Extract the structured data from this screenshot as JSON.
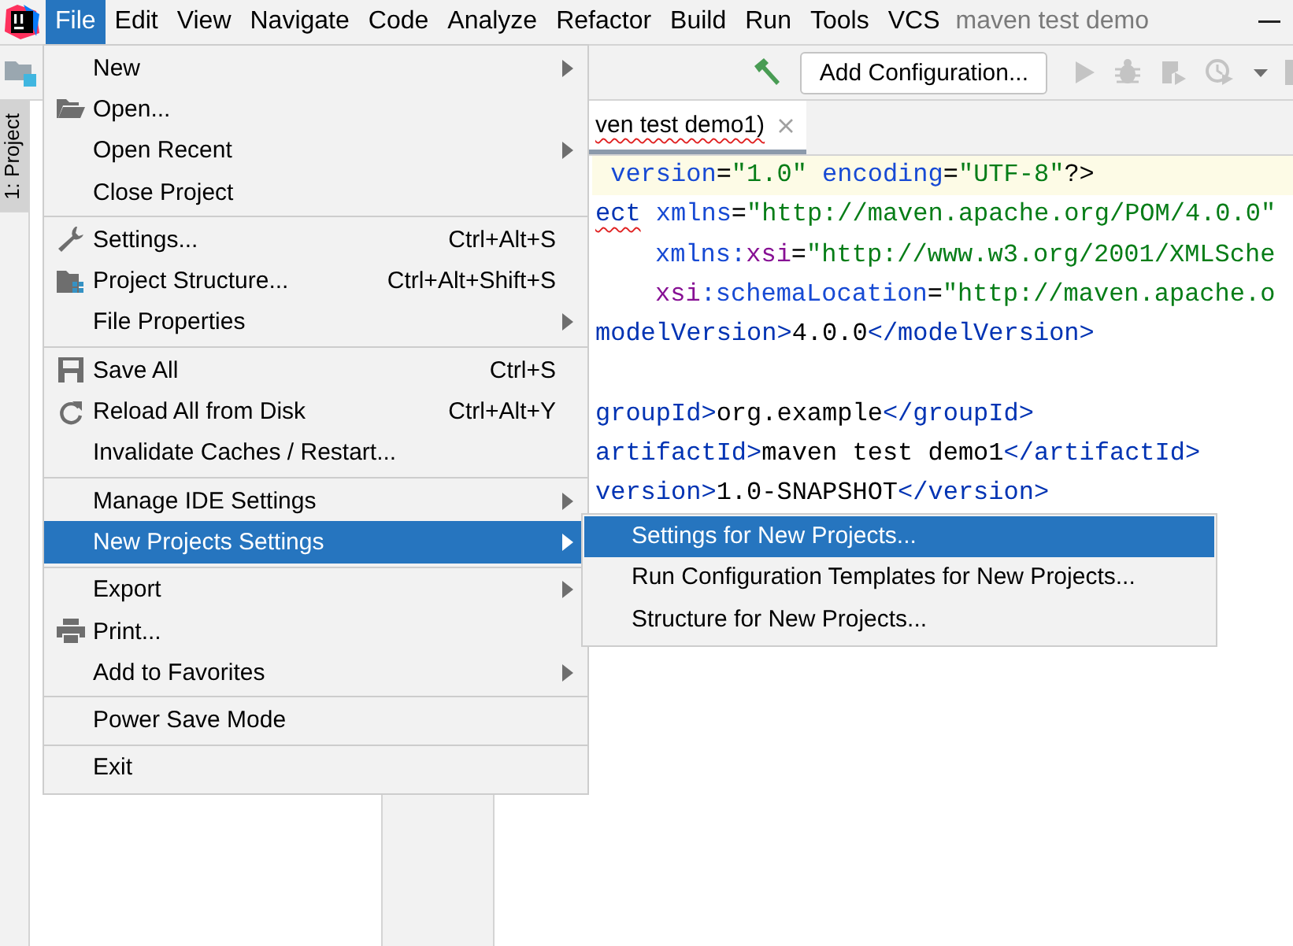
{
  "window": {
    "title": "maven test demo"
  },
  "menu_bar": [
    {
      "label": "File",
      "selected": true
    },
    {
      "label": "Edit",
      "selected": false
    },
    {
      "label": "View",
      "selected": false
    },
    {
      "label": "Navigate",
      "selected": false
    },
    {
      "label": "Code",
      "selected": false
    },
    {
      "label": "Analyze",
      "selected": false
    },
    {
      "label": "Refactor",
      "selected": false
    },
    {
      "label": "Build",
      "selected": false
    },
    {
      "label": "Run",
      "selected": false
    },
    {
      "label": "Tools",
      "selected": false
    },
    {
      "label": "VCS",
      "selected": false
    }
  ],
  "toolbar": {
    "run_configuration": "Add Configuration..."
  },
  "tool_window_stripe": [
    {
      "label": "1: Project",
      "selected": true
    }
  ],
  "editor": {
    "tab": {
      "title": "ven test demo1)",
      "misspelled": true
    },
    "lines": [
      {
        "current": true,
        "gap_before": false,
        "tokens": [
          {
            "kind": "attr",
            "text": " version"
          },
          {
            "kind": "text",
            "text": "="
          },
          {
            "kind": "value",
            "text": "\"1.0\""
          },
          {
            "kind": "attr",
            "text": " encoding"
          },
          {
            "kind": "text",
            "text": "="
          },
          {
            "kind": "value",
            "text": "\"UTF-8\""
          },
          {
            "kind": "text",
            "text": "?>"
          }
        ]
      },
      {
        "current": false,
        "gap_before": false,
        "tokens": [
          {
            "kind": "tag",
            "text": "ect",
            "misspelled": true
          },
          {
            "kind": "attr",
            "text": " xmlns"
          },
          {
            "kind": "text",
            "text": "="
          },
          {
            "kind": "value",
            "text": "\"http://maven.apache.org/POM/4.0.0\""
          }
        ]
      },
      {
        "current": false,
        "gap_before": false,
        "indent": true,
        "tokens": [
          {
            "kind": "attr",
            "text": "xmlns:"
          },
          {
            "kind": "ns",
            "text": "xsi"
          },
          {
            "kind": "text",
            "text": "="
          },
          {
            "kind": "value",
            "text": "\"http://www.w3.org/2001/XMLSche"
          }
        ]
      },
      {
        "current": false,
        "gap_before": false,
        "indent": true,
        "tokens": [
          {
            "kind": "ns",
            "text": "xsi"
          },
          {
            "kind": "attr",
            "text": ":schemaLocation"
          },
          {
            "kind": "text",
            "text": "="
          },
          {
            "kind": "value",
            "text": "\"http://maven.apache.o"
          }
        ]
      },
      {
        "current": false,
        "gap_before": false,
        "tokens": [
          {
            "kind": "tag",
            "text": "modelVersion>"
          },
          {
            "kind": "text",
            "text": "4.0.0"
          },
          {
            "kind": "tag",
            "text": "</modelVersion>"
          }
        ]
      },
      {
        "current": false,
        "gap_before": true,
        "tokens": [
          {
            "kind": "tag",
            "text": "groupId>"
          },
          {
            "kind": "text",
            "text": "org.example"
          },
          {
            "kind": "tag",
            "text": "</groupId>"
          }
        ]
      },
      {
        "current": false,
        "gap_before": false,
        "tokens": [
          {
            "kind": "tag",
            "text": "artifactId>"
          },
          {
            "kind": "text",
            "text": "maven test demo1"
          },
          {
            "kind": "tag",
            "text": "</artifactId>"
          }
        ]
      },
      {
        "current": false,
        "gap_before": false,
        "tokens": [
          {
            "kind": "tag",
            "text": "version>"
          },
          {
            "kind": "text",
            "text": "1.0-SNAPSHOT"
          },
          {
            "kind": "tag",
            "text": "</version>"
          }
        ]
      }
    ]
  },
  "file_menu": {
    "items": [
      {
        "kind": "item",
        "label": "New",
        "submenu": true,
        "selected": false
      },
      {
        "kind": "item",
        "label": "Open...",
        "submenu": false,
        "selected": false
      },
      {
        "kind": "item",
        "label": "Open Recent",
        "submenu": true,
        "selected": false
      },
      {
        "kind": "item",
        "label": "Close Project",
        "submenu": false,
        "selected": false
      },
      {
        "kind": "separator"
      },
      {
        "kind": "item",
        "label": "Settings...",
        "shortcut": "Ctrl+Alt+S",
        "submenu": false,
        "selected": false
      },
      {
        "kind": "item",
        "label": "Project Structure...",
        "shortcut": "Ctrl+Alt+Shift+S",
        "submenu": false,
        "selected": false
      },
      {
        "kind": "item",
        "label": "File Properties",
        "submenu": true,
        "selected": false
      },
      {
        "kind": "separator"
      },
      {
        "kind": "item",
        "label": "Save All",
        "shortcut": "Ctrl+S",
        "submenu": false,
        "selected": false
      },
      {
        "kind": "item",
        "label": "Reload All from Disk",
        "shortcut": "Ctrl+Alt+Y",
        "submenu": false,
        "selected": false
      },
      {
        "kind": "item",
        "label": "Invalidate Caches / Restart...",
        "submenu": false,
        "selected": false
      },
      {
        "kind": "separator"
      },
      {
        "kind": "item",
        "label": "Manage IDE Settings",
        "submenu": true,
        "selected": false
      },
      {
        "kind": "item",
        "label": "New Projects Settings",
        "submenu": true,
        "selected": true
      },
      {
        "kind": "separator"
      },
      {
        "kind": "item",
        "label": "Export",
        "submenu": true,
        "selected": false
      },
      {
        "kind": "item",
        "label": "Print...",
        "submenu": false,
        "selected": false
      },
      {
        "kind": "item",
        "label": "Add to Favorites",
        "submenu": true,
        "selected": false
      },
      {
        "kind": "separator"
      },
      {
        "kind": "item",
        "label": "Power Save Mode",
        "submenu": false,
        "selected": false
      },
      {
        "kind": "separator"
      },
      {
        "kind": "item",
        "label": "Exit",
        "submenu": false,
        "selected": false
      }
    ]
  },
  "submenu": {
    "items": [
      {
        "label": "Settings for New Projects...",
        "selected": true
      },
      {
        "label": "Run Configuration Templates for New Projects...",
        "selected": false
      },
      {
        "label": "Structure for New Projects...",
        "selected": false
      }
    ]
  }
}
